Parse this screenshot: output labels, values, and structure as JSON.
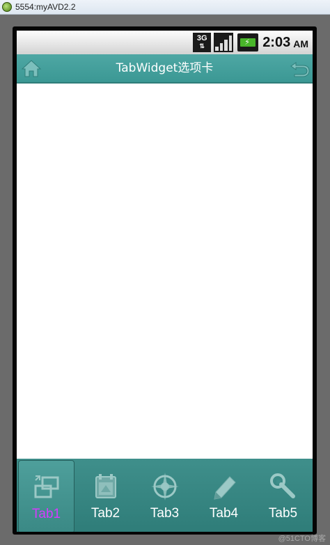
{
  "window": {
    "title": "5554:myAVD2.2"
  },
  "statusbar": {
    "network": "3G",
    "time": "2:03",
    "ampm": "AM"
  },
  "app": {
    "title": "TabWidget选项卡"
  },
  "tabs": [
    {
      "label": "Tab1",
      "icon": "crop-icon",
      "selected": true
    },
    {
      "label": "Tab2",
      "icon": "calendar-icon",
      "selected": false
    },
    {
      "label": "Tab3",
      "icon": "compass-icon",
      "selected": false
    },
    {
      "label": "Tab4",
      "icon": "pencil-icon",
      "selected": false
    },
    {
      "label": "Tab5",
      "icon": "wrench-icon",
      "selected": false
    }
  ],
  "watermark": "@51CTO博客",
  "colors": {
    "accent": "#3f8f8b",
    "selected_label": "#d63bff"
  }
}
